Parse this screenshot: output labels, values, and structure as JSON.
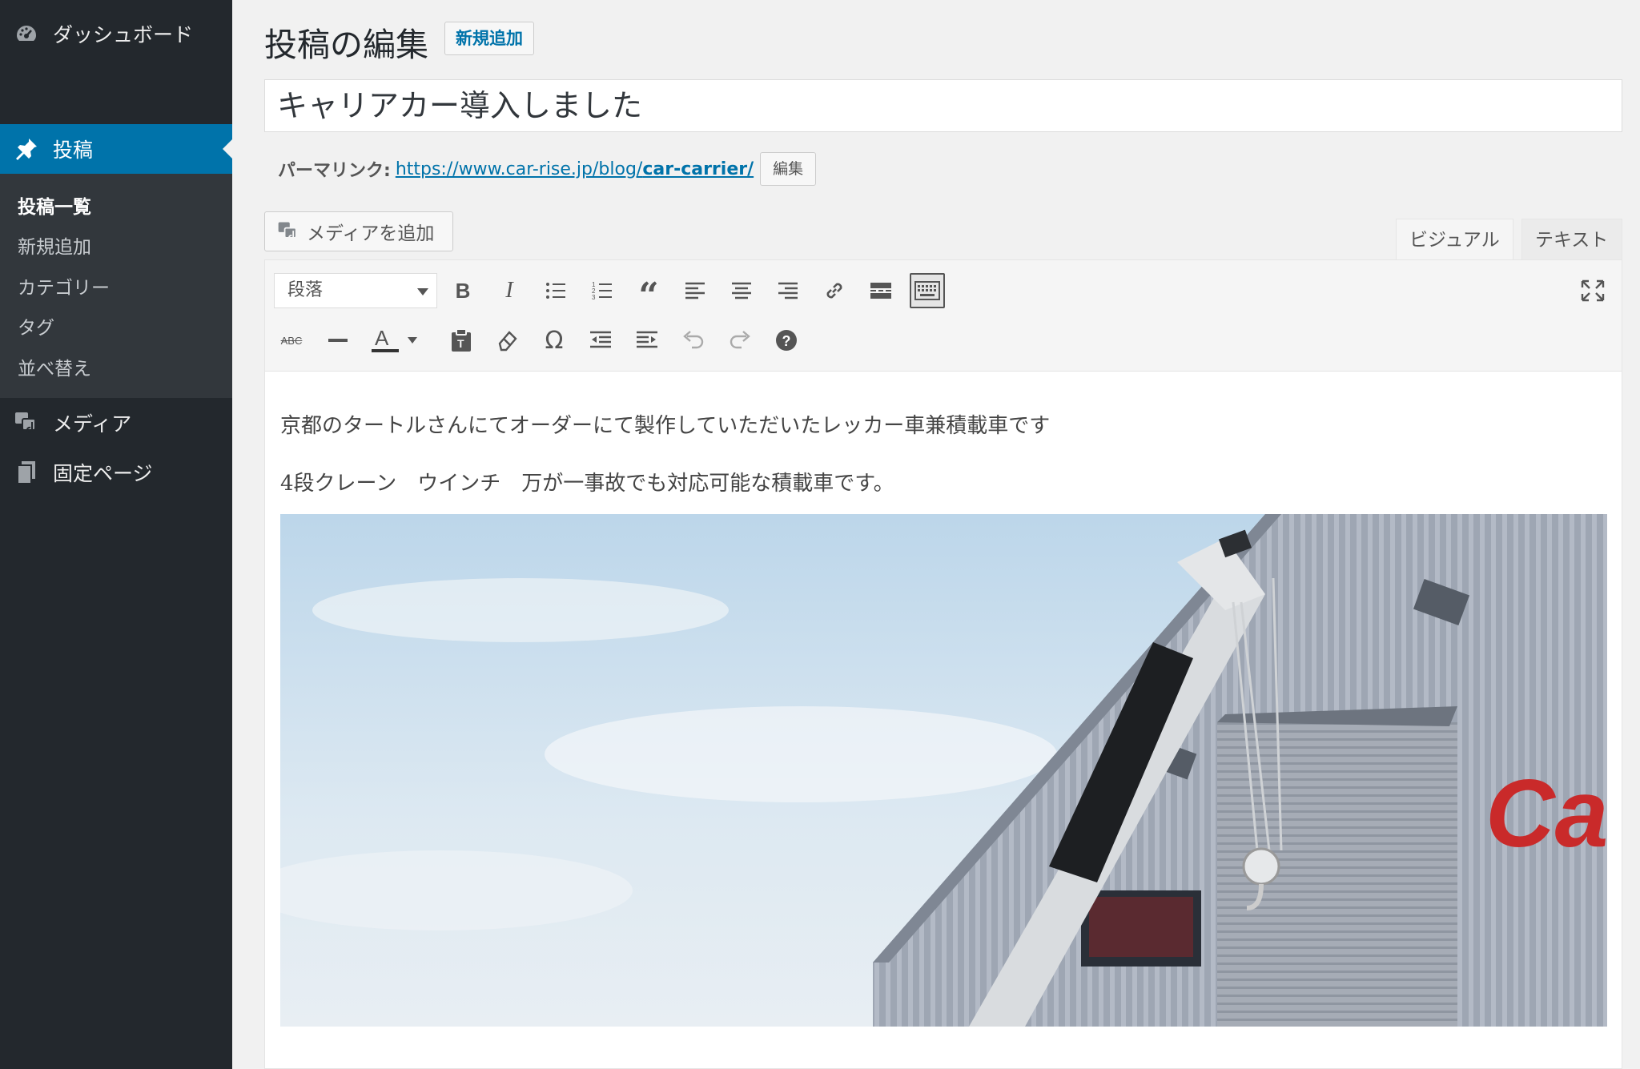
{
  "sidebar": {
    "dashboard_label": "ダッシュボード",
    "posts_label": "投稿",
    "submenu": [
      "投稿一覧",
      "新規追加",
      "カテゴリー",
      "タグ",
      "並べ替え"
    ],
    "media_label": "メディア",
    "pages_label": "固定ページ"
  },
  "header": {
    "title": "投稿の編集",
    "add_new_label": "新規追加"
  },
  "post": {
    "title": "キャリアカー導入しました",
    "permalink_label": "パーマリンク:",
    "permalink_base": "https://www.car-rise.jp/blog/",
    "permalink_slug": "car-carrier/",
    "permalink_edit_label": "編集"
  },
  "editor": {
    "add_media_label": "メディアを追加",
    "tab_visual": "ビジュアル",
    "tab_text": "テキスト",
    "format_select_value": "段落",
    "paragraphs": [
      "京都のタートルさんにてオーダーにて製作していただいたレッカー車兼積載車です",
      "4段クレーン　ウインチ　万が一事故でも対応可能な積載車です。"
    ],
    "photo_sign_text": "Ca"
  },
  "colors": {
    "sidebar_bg": "#23282d",
    "submenu_bg": "#32373c",
    "accent": "#0073aa",
    "page_bg": "#f1f1f1"
  }
}
